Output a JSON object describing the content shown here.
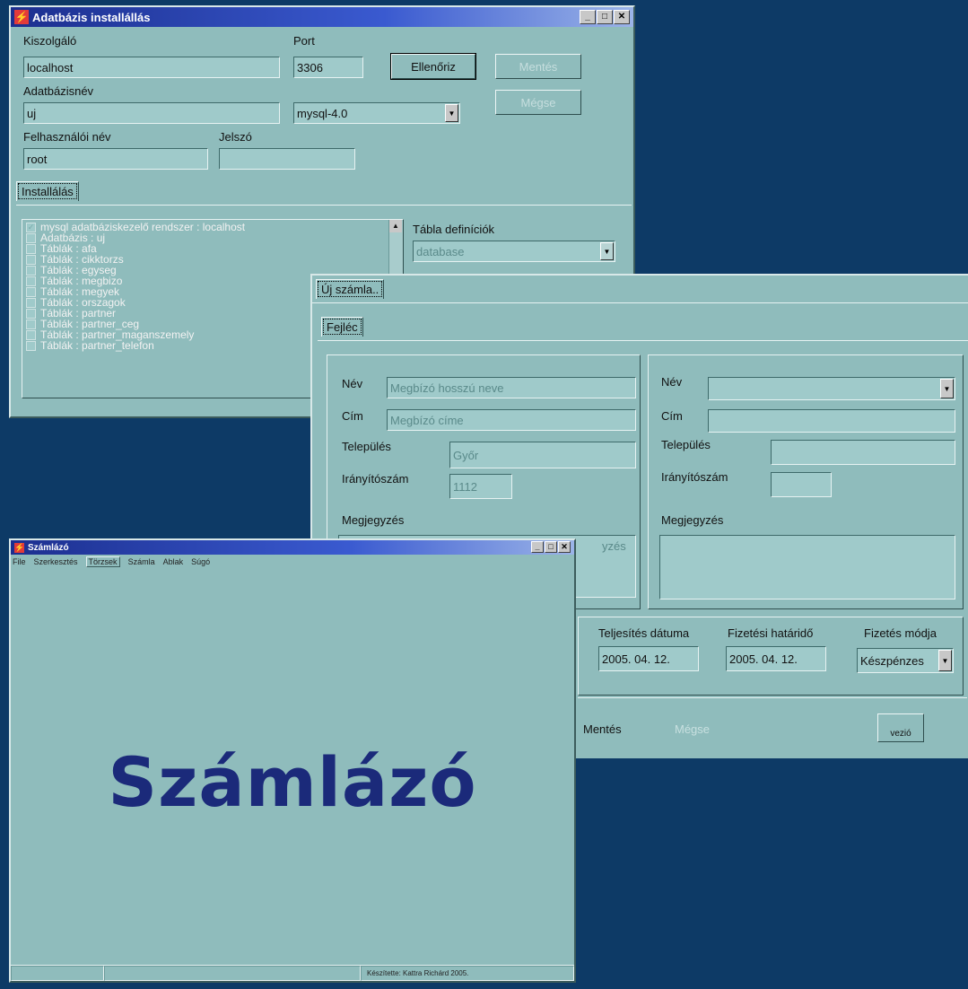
{
  "install_window": {
    "title": "Adatbázis installállás",
    "labels": {
      "host": "Kiszolgáló",
      "port": "Port",
      "dbname": "Adatbázisnév",
      "user": "Felhasználói név",
      "password": "Jelszó",
      "tables_def": "Tábla definíciók"
    },
    "values": {
      "host": "localhost",
      "port": "3306",
      "dbname": "uj",
      "user": "root",
      "password": "",
      "db_version": "mysql-4.0",
      "tables_def": "database"
    },
    "buttons": {
      "check": "Ellenőriz",
      "save": "Mentés",
      "cancel": "Mégse"
    },
    "tab": "Installálás",
    "list_items": [
      "mysql adatbáziskezelő rendszer : localhost",
      "Adatbázis : uj",
      "Táblák : afa",
      "Táblák : cikktorzs",
      "Táblák : egyseg",
      "Táblák : megbizo",
      "Táblák : megyek",
      "Táblák : orszagok",
      "Táblák : partner",
      "Táblák : partner_ceg",
      "Táblák : partner_maganszemely",
      "Táblák : partner_telefon"
    ]
  },
  "invoice_window": {
    "outer_tab": "Új számla..",
    "inner_tab": "Fejléc",
    "left": {
      "name_label": "Név",
      "name_value": "Megbízó hosszú neve",
      "address_label": "Cím",
      "address_value": "Megbízó címe",
      "city_label": "Település",
      "city_value": "Győr",
      "zip_label": "Irányítószám",
      "zip_value": "1112",
      "note_label": "Megjegyzés",
      "note_value": "yzés"
    },
    "right": {
      "name_label": "Név",
      "address_label": "Cím",
      "city_label": "Település",
      "zip_label": "Irányítószám",
      "note_label": "Megjegyzés"
    },
    "dates": {
      "fulfill_label": "Teljesítés dátuma",
      "fulfill_value": "2005. 04. 12.",
      "deadline_label": "Fizetési határidő",
      "deadline_value": "2005. 04. 12.",
      "payment_label": "Fizetés módja",
      "payment_value": "Készpénzes"
    },
    "footer": {
      "save": "Mentés",
      "cancel": "Mégse",
      "extra": "vezió"
    }
  },
  "main_window": {
    "title": "Számlázó",
    "menu": [
      "File",
      "Szerkesztés",
      "Törzsek",
      "Számla",
      "Ablak",
      "Súgó"
    ],
    "brand": "Számlázó",
    "status": "Készítette: Kattra Richárd 2005."
  },
  "colors": {
    "desktop": "#0d3a66",
    "window": "#8fbcbc",
    "brand": "#1b2a7a"
  }
}
